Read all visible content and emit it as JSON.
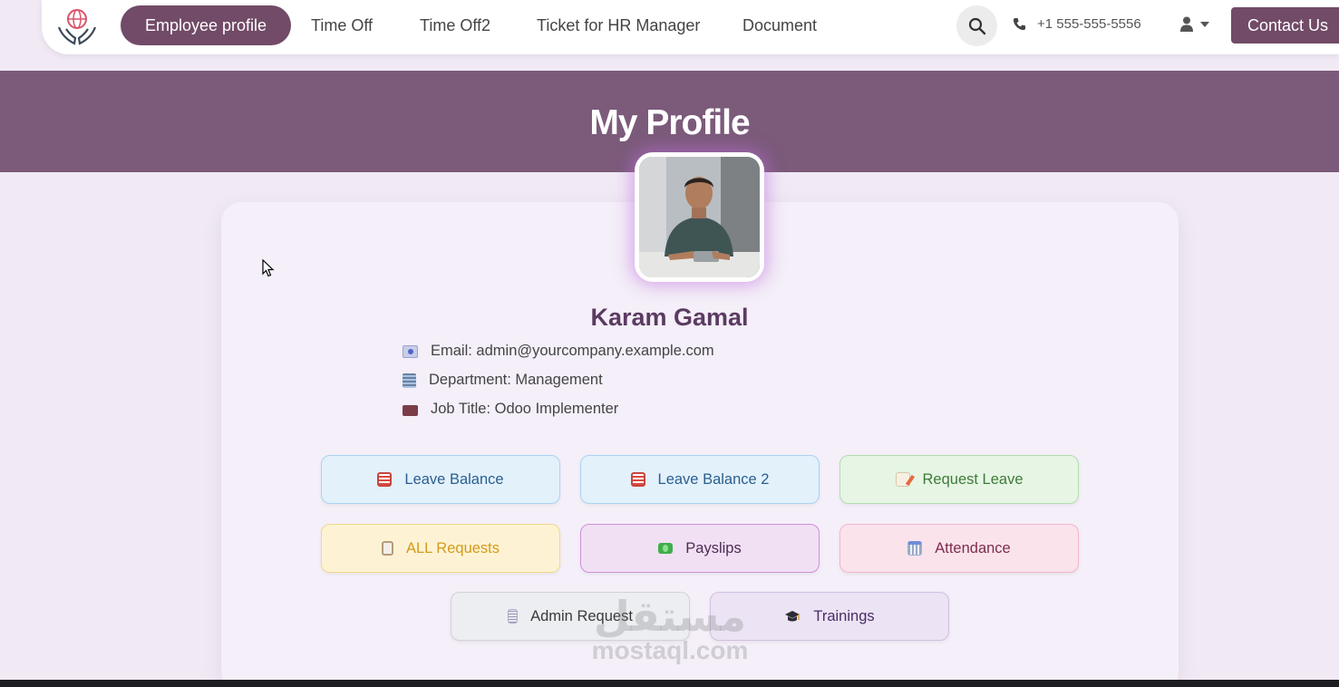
{
  "nav": {
    "items": [
      {
        "label": "Employee profile",
        "active": true
      },
      {
        "label": "Time Off"
      },
      {
        "label": "Time Off2"
      },
      {
        "label": "Ticket for HR Manager"
      },
      {
        "label": "Document"
      }
    ],
    "phone": "+1 555-555-5556",
    "contact_label": "Contact Us",
    "icons": {
      "search": "search-icon",
      "phone": "phone-icon",
      "user": "user-icon",
      "caret": "caret-down-icon",
      "logo": "hands-globe-logo"
    }
  },
  "hero": {
    "title": "My Profile"
  },
  "profile": {
    "name": "Karam Gamal",
    "email": "Email: admin@yourcompany.example.com",
    "department": "Department: Management",
    "job_title": "Job Title: Odoo Implementer"
  },
  "actions": [
    {
      "label": "Leave Balance",
      "icon": "abacus-icon"
    },
    {
      "label": "Leave Balance 2",
      "icon": "abacus-icon"
    },
    {
      "label": "Request Leave",
      "icon": "memo-icon"
    },
    {
      "label": "ALL Requests",
      "icon": "clipboard-icon"
    },
    {
      "label": "Payslips",
      "icon": "money-icon"
    },
    {
      "label": "Attendance",
      "icon": "calendar-icon"
    },
    {
      "label": "Admin Request",
      "icon": "receipt-icon"
    },
    {
      "label": "Trainings",
      "icon": "graduation-cap-icon"
    }
  ],
  "watermark": {
    "arabic": "مستقل",
    "latin": "mostaql.com"
  },
  "colors": {
    "primary": "#714b67",
    "hero": "#7b5a7a",
    "name": "#5b3b62"
  }
}
